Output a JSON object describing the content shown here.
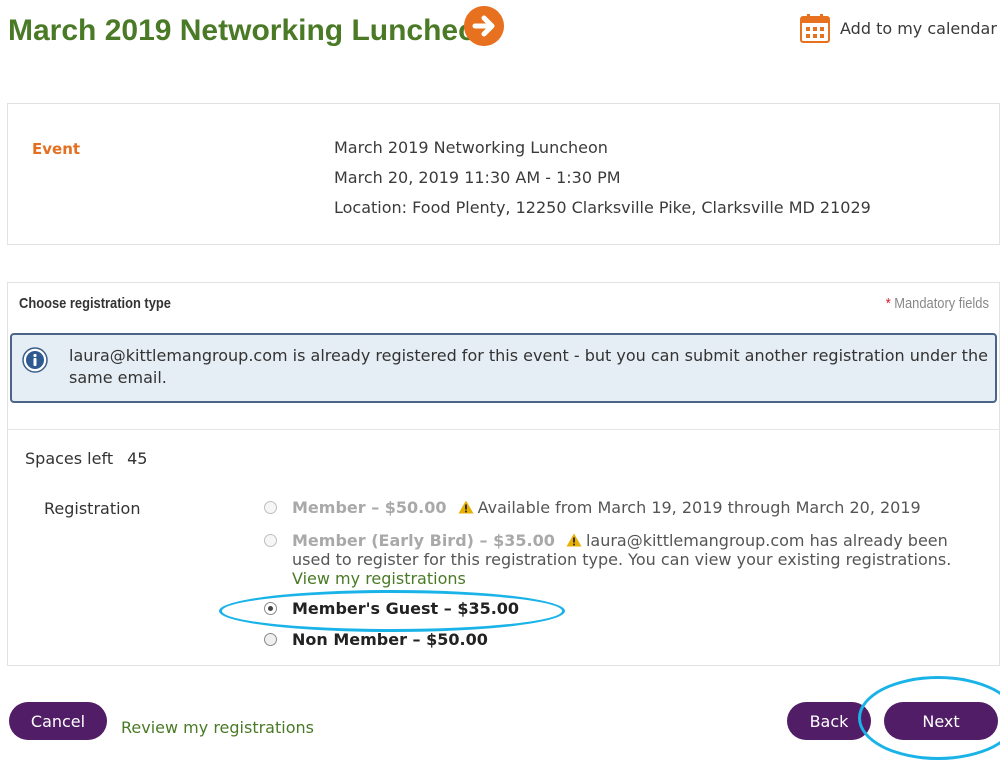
{
  "header": {
    "title": "March 2019 Networking Luncheon",
    "title_icon": "arrow-right-circle-icon",
    "calendar_link": "Add to my calendar",
    "calendar_icon": "calendar-icon"
  },
  "event": {
    "label": "Event",
    "name": "March 2019 Networking Luncheon",
    "datetime": "March 20, 2019 11:30 AM - 1:30 PM",
    "location": "Location: Food Plenty, 12250 Clarksville Pike, Clarksville MD 21029"
  },
  "registration_form": {
    "heading": "Choose registration type",
    "mandatory_star": "*",
    "mandatory_text": "Mandatory fields",
    "notice": "laura@kittlemangroup.com is already registered for this event - but you can submit another registration under the same email.",
    "spaces_label": "Spaces left",
    "spaces_value": "45",
    "registration_label": "Registration",
    "options": [
      {
        "name": "Member – $50.00",
        "enabled": false,
        "selected": false,
        "note": "Available from March 19, 2019 through March 20, 2019"
      },
      {
        "name": "Member (Early Bird) – $35.00",
        "enabled": false,
        "selected": false,
        "note": "laura@kittlemangroup.com has already been used to register for this registration type. You can view your existing registrations.",
        "link": "View my registrations"
      },
      {
        "name": "Member's Guest – $35.00",
        "enabled": true,
        "selected": true
      },
      {
        "name": "Non Member – $50.00",
        "enabled": true,
        "selected": false
      }
    ]
  },
  "footer": {
    "cancel_label": "Cancel",
    "review_link": "Review my registrations",
    "back_label": "Back",
    "next_label": "Next"
  },
  "colors": {
    "title_green": "#4a7a26",
    "accent_orange": "#e37020",
    "button_purple": "#501d66",
    "notice_bg": "#e5edf5",
    "notice_border": "#4b6587",
    "highlight_cyan": "#19b3e8"
  }
}
